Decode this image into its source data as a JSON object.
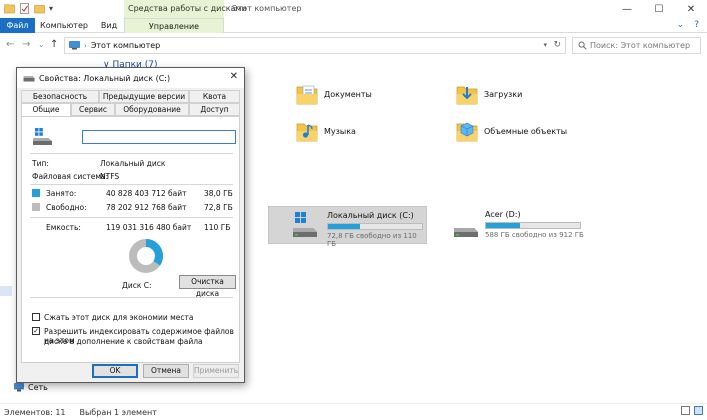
{
  "window": {
    "title": "Этот компьютер",
    "context_title": "Средства работы с дисками",
    "controls": [
      "—",
      "☐",
      "✕"
    ]
  },
  "ribbon": {
    "tabs": [
      "Файл",
      "Компьютер",
      "Вид",
      "Управление"
    ],
    "right": [
      "⌄",
      "?"
    ]
  },
  "nav": {
    "back": "←",
    "forward": "→",
    "recent": "⌄",
    "up": "↑",
    "address": "Этот компьютер",
    "search_placeholder": "Поиск: Этот компьютер"
  },
  "content": {
    "folders_header": "∨ Папки (7)",
    "folders": [
      "Документы",
      "Загрузки",
      "Музыка",
      "Объемные объекты"
    ],
    "drives": [
      {
        "name": "Локальный диск (C:)",
        "free": "72,8 ГБ свободно из 110 ГБ",
        "used_fraction": 0.34
      },
      {
        "name": "Acer (D:)",
        "free": "588 ГБ свободно из 912 ГБ",
        "used_fraction": 0.36
      }
    ],
    "network": "Сеть"
  },
  "status": {
    "items": "Элементов: 11",
    "selected": "Выбран 1 элемент"
  },
  "dialog": {
    "title": "Свойства: Локальный диск (C:)",
    "close": "✕",
    "tabs_row1": [
      "Безопасность",
      "Предыдущие версии",
      "Квота"
    ],
    "tabs_row2": [
      "Общие",
      "Сервис",
      "Оборудование",
      "Доступ"
    ],
    "name_value": "",
    "type_label": "Тип:",
    "type_value": "Локальный диск",
    "fs_label": "Файловая система:",
    "fs_value": "NTFS",
    "used_label": "Занято:",
    "used_bytes": "40 828 403 712 байт",
    "used_gb": "38,0 ГБ",
    "free_label": "Свободно:",
    "free_bytes": "78 202 912 768 байт",
    "free_gb": "72,8 ГБ",
    "capacity_label": "Емкость:",
    "capacity_bytes": "119 031 316 480 байт",
    "capacity_gb": "110 ГБ",
    "used_fraction": 0.343,
    "disk_label": "Диск C:",
    "cleanup": "Очистка диска",
    "compress": "Сжать этот диск для экономии места",
    "index_line1": "Разрешить индексировать содержимое файлов на этом",
    "index_line2": "диске в дополнение к свойствам файла",
    "compress_checked": false,
    "index_checked": true,
    "ok": "OK",
    "cancel": "Отмена",
    "apply": "Применить"
  },
  "colors": {
    "used": "#26a0da",
    "free": "#bcbcbc",
    "accent": "#1a6fc2",
    "context": "#e7f3d2"
  }
}
